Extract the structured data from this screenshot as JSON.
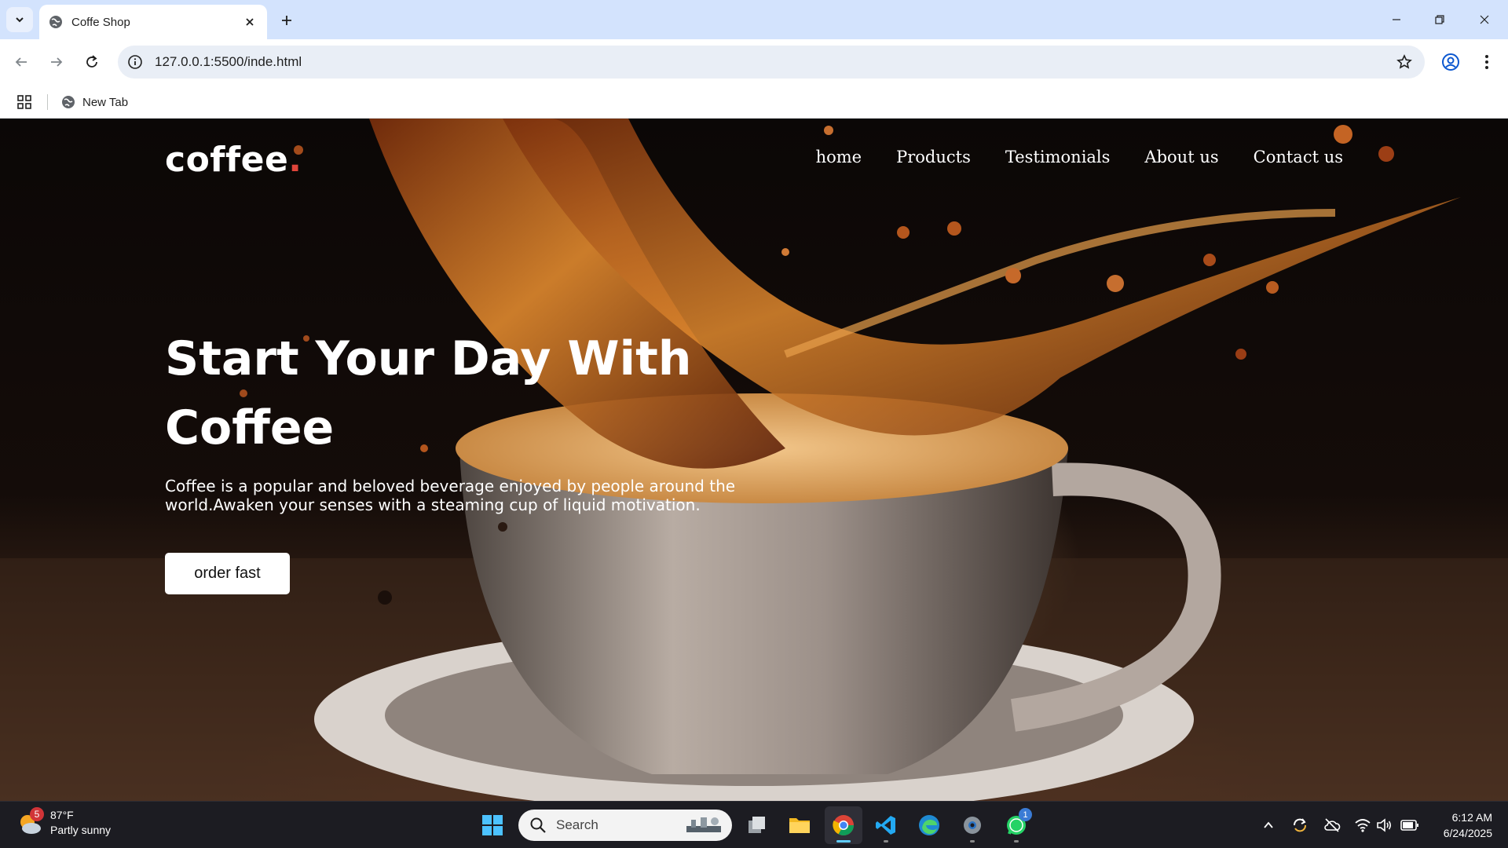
{
  "browser": {
    "tab_title": "Coffe Shop",
    "url": "127.0.0.1:5500/inde.html",
    "bookmark_label": "New Tab"
  },
  "site": {
    "brand": "coffee",
    "brand_dot": ".",
    "nav": [
      "home",
      "Products",
      "Testimonials",
      "About us",
      "Contact us"
    ],
    "hero_title": "Start Your Day With Coffee",
    "hero_text": "Coffee is a popular and beloved beverage enjoyed by people around the world.Awaken your senses with a steaming cup of liquid motivation.",
    "cta_label": "order fast",
    "colors": {
      "brand_dot": "#e0453a",
      "cta_bg": "#ffffff",
      "text": "#ffffff"
    }
  },
  "taskbar": {
    "weather_badge": "5",
    "temperature": "87°F",
    "condition": "Partly sunny",
    "search_placeholder": "Search",
    "whatsapp_badge": "1",
    "time": "6:12 AM",
    "date": "6/24/2025"
  }
}
